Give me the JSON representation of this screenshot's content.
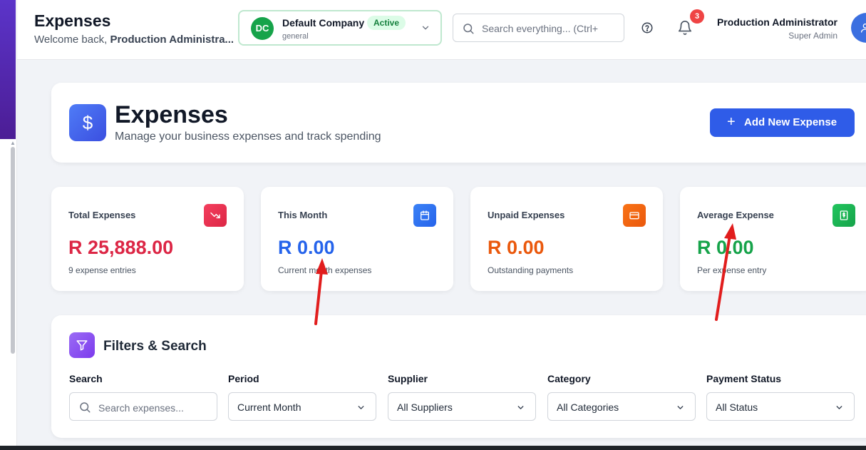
{
  "header": {
    "title": "Expenses",
    "welcome_prefix": "Welcome back, ",
    "welcome_user": "Production Administra..."
  },
  "company": {
    "initials": "DC",
    "name": "Default Company",
    "status": "Active",
    "subtitle": "general"
  },
  "search": {
    "placeholder": "Search everything... (Ctrl+"
  },
  "notifications": {
    "count": "3"
  },
  "user": {
    "name": "Production Administrator",
    "role": "Super Admin"
  },
  "hero": {
    "icon_glyph": "$",
    "title": "Expenses",
    "subtitle": "Manage your business expenses and track spending",
    "add_button_plus": "+",
    "add_button": "Add New Expense"
  },
  "stats": [
    {
      "title": "Total Expenses",
      "value": "R 25,888.00",
      "desc": "9 expense entries",
      "color": "#dc2645",
      "icon": "trending-down-icon"
    },
    {
      "title": "This Month",
      "value": "R 0.00",
      "desc": "Current month expenses",
      "color": "#2563eb",
      "icon": "calendar-icon"
    },
    {
      "title": "Unpaid Expenses",
      "value": "R 0.00",
      "desc": "Outstanding payments",
      "color": "#ea580c",
      "icon": "credit-card-icon"
    },
    {
      "title": "Average Expense",
      "value": "R 0.00",
      "desc": "Per expense entry",
      "color": "#16a34a",
      "icon": "dollar-receipt-icon"
    }
  ],
  "filters": {
    "title": "Filters & Search",
    "search_label": "Search",
    "search_placeholder": "Search expenses...",
    "period_label": "Period",
    "period_value": "Current Month",
    "supplier_label": "Supplier",
    "supplier_value": "All Suppliers",
    "category_label": "Category",
    "category_value": "All Categories",
    "status_label": "Payment Status",
    "status_value": "All Status"
  },
  "colors": {
    "accent": "#2f5ce8",
    "sidebar": "#4c1d95",
    "annotation_arrow": "#e11d1d"
  }
}
